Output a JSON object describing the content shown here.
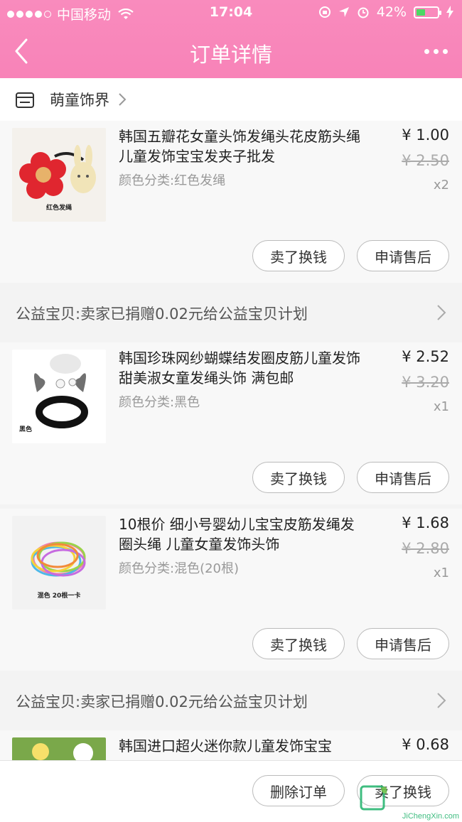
{
  "status_bar": {
    "carrier": "中国移动",
    "time": "17:04",
    "battery": "42%",
    "battery_level": 0.42
  },
  "nav": {
    "title": "订单详情"
  },
  "shop": {
    "name": "萌童饰界"
  },
  "items": [
    {
      "title": "韩国五瓣花女童头饰发绳头花皮筋头绳 儿童发饰宝宝发夹子批发",
      "spec": "颜色分类:红色发绳",
      "price": "¥ 1.00",
      "original_price": "¥ 2.50",
      "qty": "x2",
      "thumb_caption": "红色发绳",
      "sell_label": "卖了换钱",
      "aftersale_label": "申请售后"
    },
    {
      "title": "韩国珍珠网纱蝴蝶结发圈皮筋儿童发饰甜美淑女童发绳头饰 满包邮",
      "spec": "颜色分类:黑色",
      "price": "¥ 2.52",
      "original_price": "¥ 3.20",
      "qty": "x1",
      "thumb_caption": "黑色",
      "sell_label": "卖了换钱",
      "aftersale_label": "申请售后"
    },
    {
      "title": "10根价 细小号婴幼儿宝宝皮筋发绳发圈头绳 儿童女童发饰头饰",
      "spec": "颜色分类:混色(20根)",
      "price": "¥ 1.68",
      "original_price": "¥ 2.80",
      "qty": "x1",
      "thumb_caption": "混色 20根一卡",
      "sell_label": "卖了换钱",
      "aftersale_label": "申请售后"
    },
    {
      "title": "韩国进口超火迷你款儿童发饰宝宝",
      "price": "¥ 0.68"
    }
  ],
  "charity": {
    "text": "公益宝贝:卖家已捐赠0.02元给公益宝贝计划"
  },
  "bottom_bar": {
    "delete_label": "删除订单",
    "sell_label": "卖了换钱",
    "watermark": "JiChengXin.com"
  },
  "colors": {
    "header_pink": "#f883b8",
    "battery_green": "#4cd964"
  }
}
